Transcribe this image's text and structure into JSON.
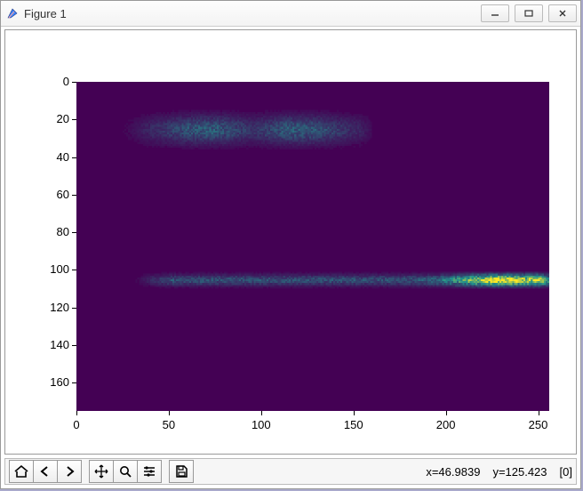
{
  "window": {
    "title": "Figure 1"
  },
  "status": {
    "x_label": "x=46.9839",
    "y_label": "y=125.423",
    "value_label": "[0]"
  },
  "toolbar_icons": {
    "home": "home-icon",
    "back": "back-icon",
    "forward": "forward-icon",
    "pan": "pan-icon",
    "zoom": "zoom-icon",
    "configure": "configure-icon",
    "save": "save-icon"
  },
  "chart_data": {
    "type": "heatmap",
    "title": "",
    "xlabel": "",
    "ylabel": "",
    "xlim": [
      0,
      256
    ],
    "ylim": [
      175,
      0
    ],
    "xticks": [
      0,
      50,
      100,
      150,
      200,
      250
    ],
    "yticks": [
      0,
      20,
      40,
      60,
      80,
      100,
      120,
      140,
      160
    ],
    "colormap": "viridis",
    "colormap_anchors": {
      "low": "#440154",
      "mid": "#21918c",
      "high": "#fde725"
    },
    "description": "2-D intensity image (likely a spectrogram) on a 256×~175 grid. Background is uniformly near the minimum value. Two bright horizontal streaks: one faint band around rows 20–30 spanning roughly columns 20–160, strongest near columns 70–120; one brighter band around rows 103–107 spanning columns ~30–256, peaking near columns 230–255 (yellow-green pixels).",
    "value_hint_at_cursor": 0,
    "nonzero_regions": [
      {
        "row_center": 25,
        "row_span": 10,
        "col_start": 20,
        "col_end": 160,
        "peak_cols": [
          70,
          120
        ],
        "intensity": "low"
      },
      {
        "row_center": 105,
        "row_span": 4,
        "col_start": 30,
        "col_end": 256,
        "peak_cols": [
          230,
          255
        ],
        "intensity": "high"
      }
    ]
  }
}
